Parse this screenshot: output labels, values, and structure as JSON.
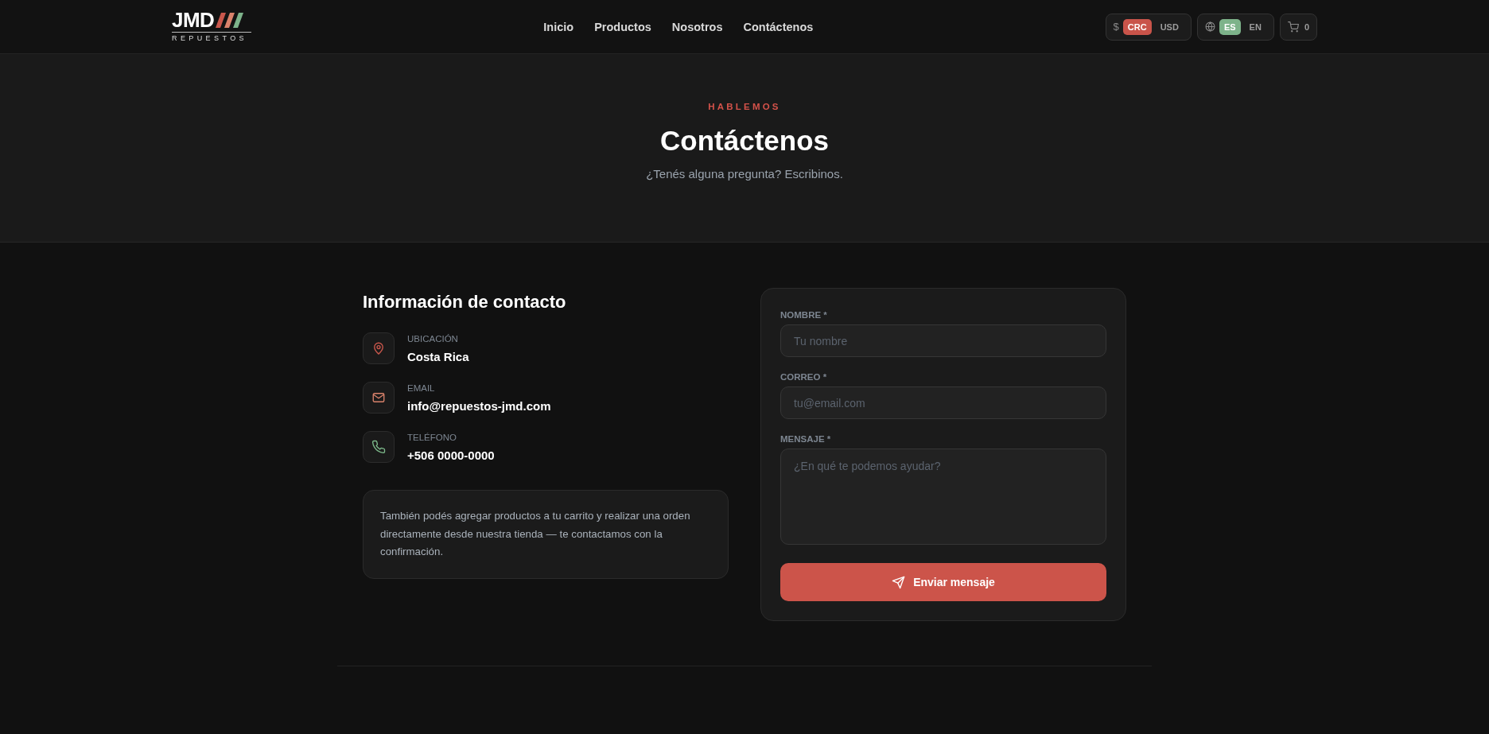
{
  "header": {
    "logo": {
      "wordmark": "JMD",
      "tagline": "REPUESTOS"
    },
    "nav": [
      "Inicio",
      "Productos",
      "Nosotros",
      "Contáctenos"
    ],
    "currency": {
      "symbol": "$",
      "options": [
        {
          "label": "CRC",
          "selected": true
        },
        {
          "label": "USD",
          "selected": false
        }
      ]
    },
    "language": {
      "options": [
        {
          "label": "ES",
          "selected": true
        },
        {
          "label": "EN",
          "selected": false
        }
      ]
    },
    "cart": {
      "count": "0"
    }
  },
  "hero": {
    "eyebrow": "HABLEMOS",
    "title": "Contáctenos",
    "subtitle": "¿Tenés alguna pregunta? Escribinos."
  },
  "contact_info": {
    "title": "Información de contacto",
    "items": [
      {
        "kind": "location",
        "label": "UBICACIÓN",
        "value": "Costa Rica"
      },
      {
        "kind": "email",
        "label": "EMAIL",
        "value": "info@repuestos-jmd.com"
      },
      {
        "kind": "phone",
        "label": "TELÉFONO",
        "value": "+506 0000-0000"
      }
    ],
    "note": "También podés agregar productos a tu carrito y realizar una orden directamente desde nuestra tienda — te contactamos con la confirmación."
  },
  "form": {
    "fields": [
      {
        "kind": "text",
        "label": "NOMBRE *",
        "placeholder": "Tu nombre"
      },
      {
        "kind": "email",
        "label": "CORREO *",
        "placeholder": "tu@email.com"
      },
      {
        "kind": "textarea",
        "label": "MENSAJE *",
        "placeholder": "¿En qué te podemos ayudar?"
      }
    ],
    "submit": "Enviar mensaje"
  }
}
